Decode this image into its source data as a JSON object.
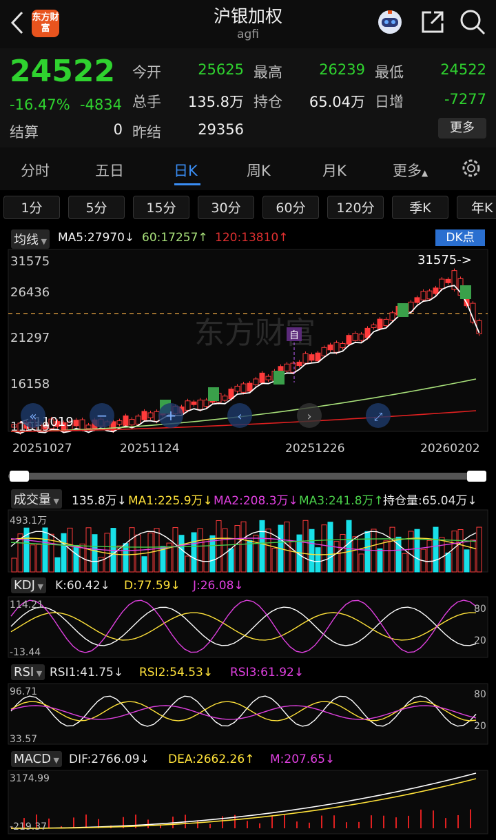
{
  "header": {
    "title": "沪银加权",
    "subtitle": "agfi",
    "logo_text": "东方财富"
  },
  "quote": {
    "price": "24522",
    "change_pct": "-16.47%",
    "change": "-4834",
    "settle_label": "结算",
    "settle": "0",
    "open_label": "今开",
    "open": "25625",
    "high_label": "最高",
    "high": "26239",
    "low_label": "最低",
    "low": "24522",
    "vol_label": "总手",
    "vol": "135.8万",
    "oi_label": "持仓",
    "oi": "65.04万",
    "daily_add_label": "日增",
    "daily_add": "-7277",
    "prev_settle_label": "昨结",
    "prev_settle": "29356",
    "more_btn": "更多"
  },
  "tabs": [
    "分时",
    "五日",
    "日K",
    "周K",
    "月K",
    "更多"
  ],
  "active_tab": "日K",
  "periods": [
    "1分",
    "5分",
    "15分",
    "30分",
    "60分",
    "120分",
    "季K",
    "年K"
  ],
  "ma_bar": {
    "selector": "均线",
    "ma5": "MA5:27970",
    "ma60": "60:17257",
    "ma120": "120:13810",
    "dk_button": "DK点"
  },
  "price_axis": [
    "31575",
    "26436",
    "21297",
    "16158",
    "11019"
  ],
  "date_axis": [
    "20251027",
    "20251124",
    "20251226",
    "20260202"
  ],
  "annotations": {
    "high": "31575->",
    "low": "<-11019",
    "self_mark": "自",
    "watermark": "东方财富"
  },
  "volume_bar": {
    "selector": "成交量",
    "vol": "135.8万",
    "ma1": "MA1:225.9万",
    "ma2": "MA2:208.3万",
    "ma3": "MA3:241.8万",
    "oi": "持仓量:65.04万",
    "axis_top": "493.1万"
  },
  "kdj_bar": {
    "selector": "KDJ",
    "k": "K:60.42",
    "d": "D:77.59",
    "j": "J:26.08",
    "axis_top": "114.21",
    "axis_bottom": "-13.44",
    "lvl80": "80",
    "lvl20": "20"
  },
  "rsi_bar": {
    "selector": "RSI",
    "rsi1": "RSI1:41.75",
    "rsi2": "RSI2:54.53",
    "rsi3": "RSI3:61.92",
    "axis_top": "96.71",
    "axis_bottom": "33.57",
    "lvl80": "80",
    "lvl20": "20"
  },
  "macd_bar": {
    "selector": "MACD",
    "dif": "DIF:2766.09",
    "dea": "DEA:2662.26",
    "m": "M:207.65",
    "axis_top": "3174.99",
    "axis_bottom": "-219.37"
  },
  "colors": {
    "up": "#ff3b3b",
    "down": "#2fd22f",
    "accent": "#3a8ef5",
    "ma5": "#ffffff",
    "ma60": "#a8e07a",
    "ma120": "#e02020"
  }
}
